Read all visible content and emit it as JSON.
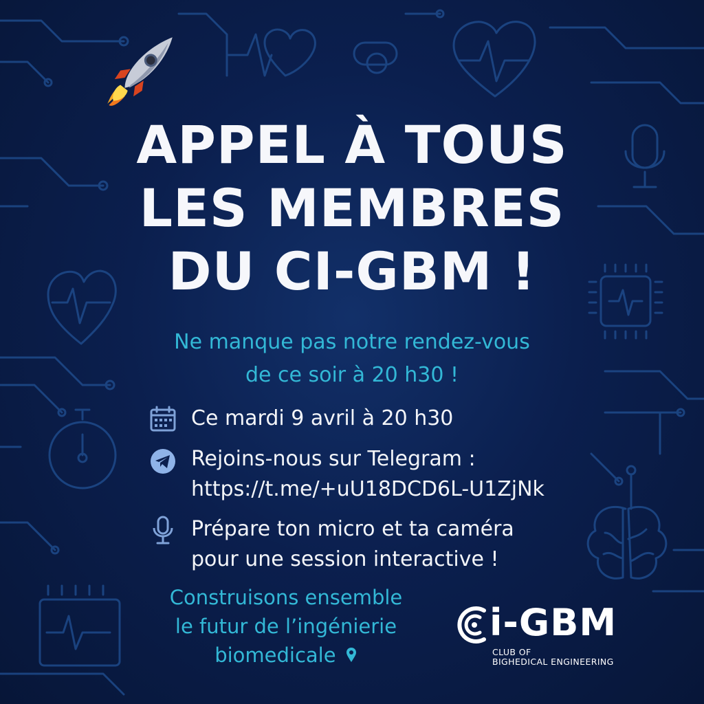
{
  "headline": {
    "line1": "APPEL À TOUS",
    "line2": "LES MEMBRES",
    "line3": "DU CI-GBM !"
  },
  "subheadline": {
    "line1": "Ne manque pas notre rendez-vous",
    "line2": "de ce soir à 20 h30 !"
  },
  "details": {
    "date": {
      "icon": "calendar-icon",
      "text": "Ce mardi 9 avril à 20 h30"
    },
    "telegram": {
      "icon": "telegram-icon",
      "line1": "Rejoins-nous sur Telegram :",
      "line2": "https://t.me/+uU18DCD6L-U1ZjNk"
    },
    "micro": {
      "icon": "microphone-icon",
      "line1": "Prépare ton micro et ta caméra",
      "line2": "pour une session interactive !"
    }
  },
  "closing": {
    "line1": "Construisons ensemble",
    "line2": "le futur de l’ingénierie",
    "line3": "biomedicale"
  },
  "logo": {
    "name": "i-GBM",
    "tagline1": "CLUB OF",
    "tagline2": "BIGHEDICAL ENGINEERING"
  },
  "colors": {
    "background": "#0b1f4e",
    "headline": "#f6f7fb",
    "accent": "#33b8d6",
    "decor": "#1e4a8a"
  },
  "decor_icons": [
    "rocket-icon",
    "heart-pulse-icon",
    "brain-icon",
    "chip-icon",
    "stopwatch-icon",
    "monitor-icon",
    "microphone-icon"
  ]
}
